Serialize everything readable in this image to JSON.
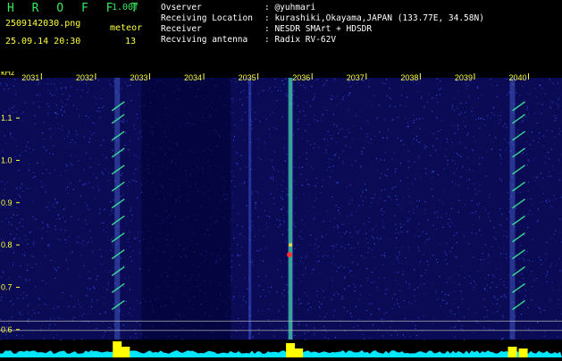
{
  "header": {
    "app_title": "H R O F F T",
    "version": "1.00f",
    "filename": "2509142030.png",
    "datetime": "25.09.14 20:30",
    "meteor_label": "meteor",
    "meteor_count": "13",
    "info_rows": [
      {
        "label": "Ovserver",
        "value": ": @yuhmari"
      },
      {
        "label": "Receiving Location",
        "value": ": kurashiki,Okayama,JAPAN (133.77E, 34.58N)"
      },
      {
        "label": "Receiver",
        "value": ": NESDR SMArt + HDSDR"
      },
      {
        "label": "Recviving antenna",
        "value": ": Radix RV-62V"
      }
    ]
  },
  "chart_data": {
    "type": "heatmap",
    "title": "",
    "xlabel": "",
    "ylabel": "kHz",
    "x_ticks": [
      "2031",
      "2032",
      "2033",
      "2034",
      "2035",
      "2036",
      "2037",
      "2038",
      "2039",
      "2040"
    ],
    "y_ticks": [
      "1.1",
      "1.0",
      "0.9",
      "0.8",
      "0.7",
      "0.6"
    ],
    "ylim": [
      0.57,
      1.21
    ],
    "colors": {
      "background": "#0a0a55",
      "noise": "#3a5cff",
      "bright_trace": "#40ff9a",
      "hot_spot": "#ff3030",
      "tick_labels": "#ffff3c",
      "amplitude_band": "#00e6ff",
      "meteor_marker": "#ffff00",
      "reference_line": "#bbbbbb"
    },
    "events": [
      {
        "type": "echo",
        "x_minute": 2032.6
      },
      {
        "type": "echo",
        "x_minute": 2035.8
      },
      {
        "type": "echo",
        "x_minute": 2039.9
      }
    ]
  }
}
